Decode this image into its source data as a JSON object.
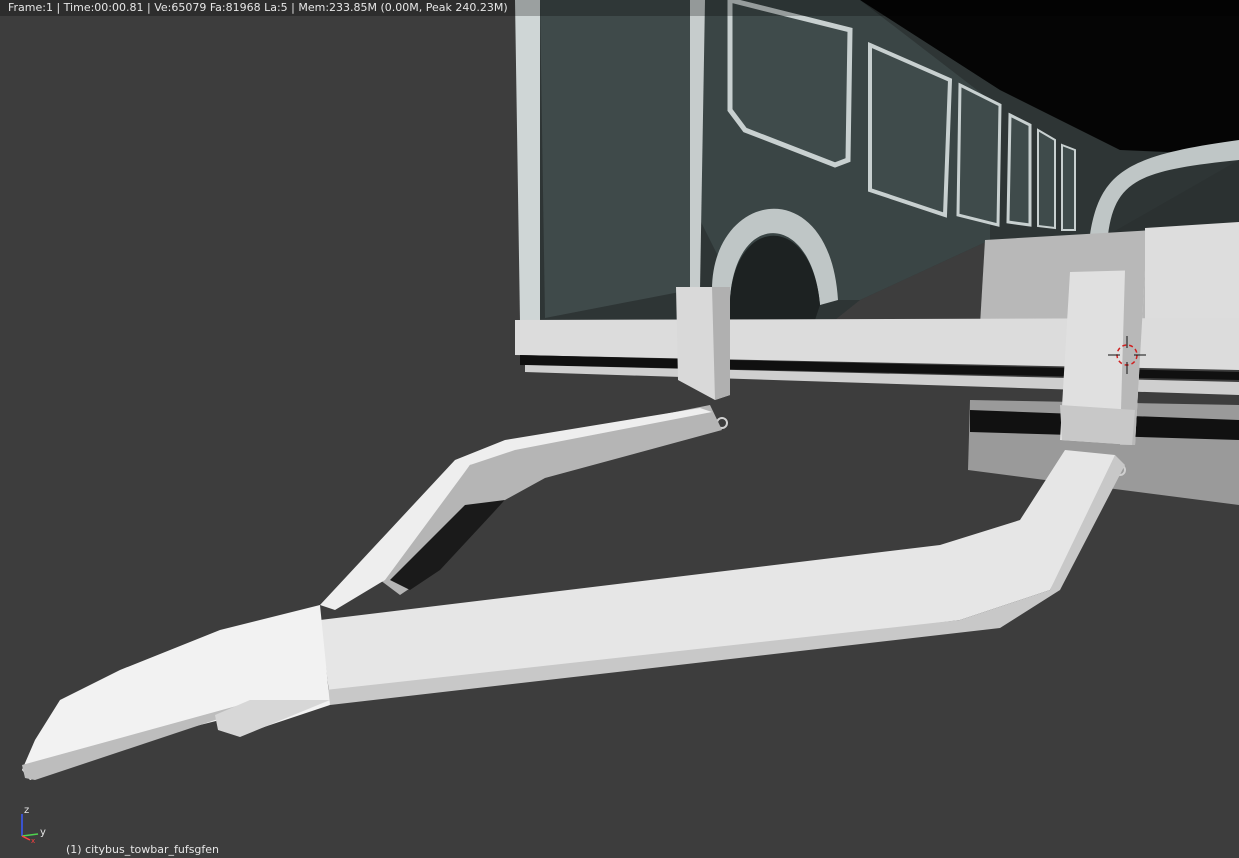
{
  "app": {
    "name": "Blender 3D Viewport"
  },
  "status_bar": {
    "text": "Frame:1 | Time:00:00.81 | Ve:65079 Fa:81968 La:5 | Mem:233.85M (0.00M, Peak 240.23M)"
  },
  "viewport": {
    "active_object_label": "(1) citybus_towbar_fufsgfen",
    "background_color": "#3d3d3d"
  },
  "axis_gizmo": {
    "z_label": "z",
    "y_label": "y",
    "x_label": "x",
    "z_color": "#3a5bff",
    "y_color": "#4fd24f",
    "x_color": "#ff4040"
  },
  "cursor_3d": {
    "icon": "3d-cursor-icon",
    "color": "#d02020"
  }
}
